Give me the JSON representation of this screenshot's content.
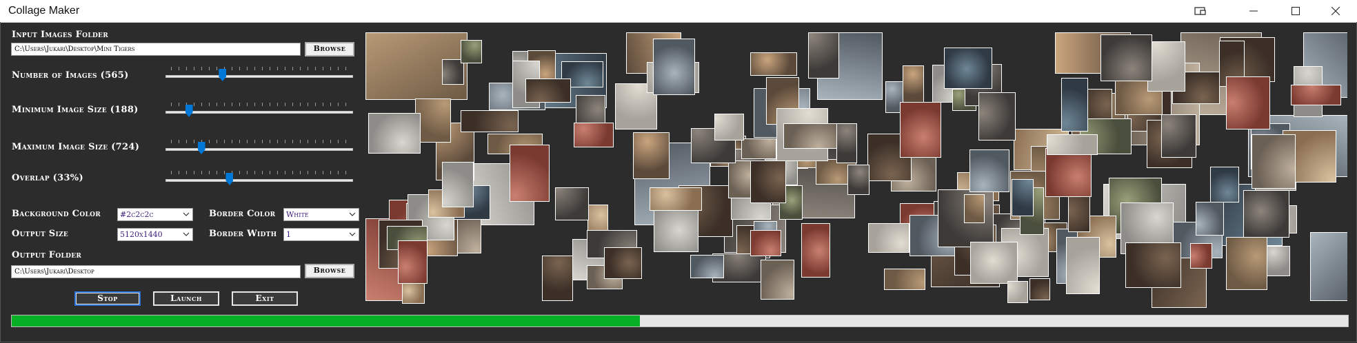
{
  "window": {
    "title": "Collage Maker",
    "controls": [
      "restore-screen-icon",
      "minimize-icon",
      "maximize-icon",
      "close-icon"
    ]
  },
  "input": {
    "label": "Input Images Folder",
    "path": "C:\\Users\\Jukari\\Desktop\\Mini Tigers",
    "browse_label": "Browse"
  },
  "sliders": {
    "num_images": {
      "label": "Number of Images (565)",
      "fraction": 0.29
    },
    "min_size": {
      "label": "Minimum Image Size (188)",
      "fraction": 0.1
    },
    "max_size": {
      "label": "Maximum Image Size (724)",
      "fraction": 0.17
    },
    "overlap": {
      "label": "Overlap (33%)",
      "fraction": 0.33
    }
  },
  "settings": {
    "background_color_label": "Background Color",
    "background_color_value": "#2c2c2c",
    "border_color_label": "Border Color",
    "border_color_value": "White",
    "output_size_label": "Output Size",
    "output_size_value": "5120x1440",
    "border_width_label": "Border Width",
    "border_width_value": "1"
  },
  "output": {
    "label": "Output Folder",
    "path": "C:\\Users\\Jukari\\Desktop",
    "browse_label": "Browse"
  },
  "actions": {
    "stop_label": "Stop",
    "launch_label": "Launch",
    "exit_label": "Exit"
  },
  "progress": {
    "fraction": 0.47
  },
  "colors": {
    "background": "#2c2c2c",
    "progress_fill": "#06b025",
    "slider_thumb": "#0078d7",
    "focus": "#2b73d8"
  }
}
